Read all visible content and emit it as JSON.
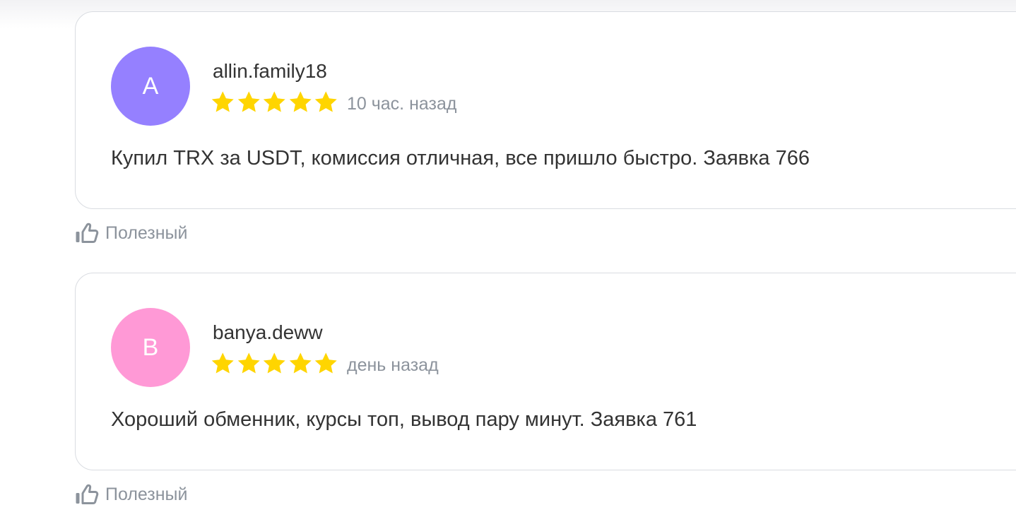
{
  "reviews": [
    {
      "initial": "A",
      "avatar_color": "#9580ff",
      "author": "allin.family18",
      "rating": 5,
      "date": "10 час. назад",
      "text": "Купил TRX за USDT, комиссия отличная, все пришло быстро. Заявка 766",
      "helpful_label": "Полезный"
    },
    {
      "initial": "B",
      "avatar_color": "#ff99d6",
      "author": "banya.deww",
      "rating": 5,
      "date": "день назад",
      "text": "Хороший обменник, курсы топ, вывод пару минут. Заявка 761",
      "helpful_label": "Полезный"
    }
  ],
  "colors": {
    "star": "#ffd500",
    "muted_text": "#8c939c",
    "body_text": "#333333",
    "card_border": "#d9dce1"
  },
  "icons": {
    "star": "star-icon",
    "helpful": "thumbs-up-icon"
  }
}
